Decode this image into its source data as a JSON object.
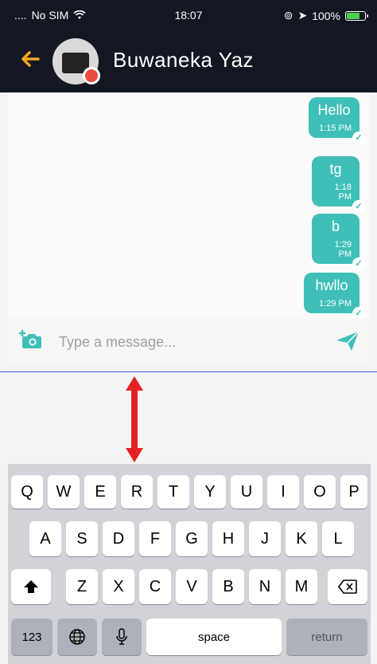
{
  "status_bar": {
    "carrier": "No SIM",
    "time": "18:07",
    "battery": "100%"
  },
  "header": {
    "contact_name": "Buwaneka Yaz"
  },
  "messages": [
    {
      "text": "Hello",
      "time": "1:15 PM"
    },
    {
      "text": "tg",
      "time": "1:18 PM"
    },
    {
      "text": "b",
      "time": "1:29 PM"
    },
    {
      "text": "hwllo",
      "time": "1:29 PM"
    }
  ],
  "composer": {
    "placeholder": "Type a message..."
  },
  "keyboard": {
    "row1": [
      "Q",
      "W",
      "E",
      "R",
      "T",
      "Y",
      "U",
      "I",
      "O",
      "P"
    ],
    "row2": [
      "A",
      "S",
      "D",
      "F",
      "G",
      "H",
      "J",
      "K",
      "L"
    ],
    "row3": [
      "Z",
      "X",
      "C",
      "V",
      "B",
      "N",
      "M"
    ],
    "numbers_label": "123",
    "space_label": "space",
    "return_label": "return"
  },
  "colors": {
    "header_bg": "#131722",
    "accent": "#f5a623",
    "bubble": "#3fbfb8"
  }
}
